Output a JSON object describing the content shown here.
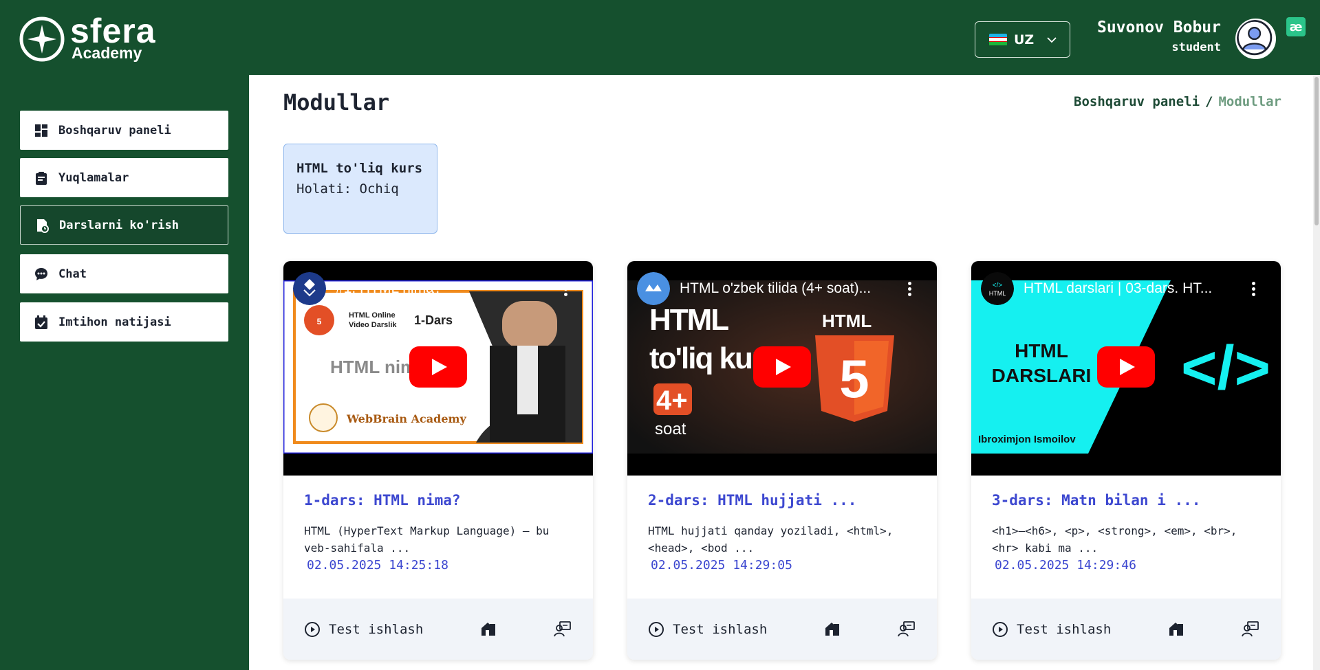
{
  "brand": {
    "name": "sfera",
    "sub": "Academy"
  },
  "header": {
    "language": "UZ",
    "user_name": "Suvonov Bobur",
    "user_role": "student",
    "ext_badge": "æ"
  },
  "sidebar": {
    "items": [
      {
        "label": "Boshqaruv paneli",
        "icon": "dashboard-icon"
      },
      {
        "label": "Yuqlamalar",
        "icon": "clipboard-icon"
      },
      {
        "label": "Darslarni ko'rish",
        "icon": "lesson-icon",
        "active": true
      },
      {
        "label": "Chat",
        "icon": "chat-icon"
      },
      {
        "label": "Imtihon natijasi",
        "icon": "calendar-check-icon"
      }
    ]
  },
  "main": {
    "title": "Modullar",
    "breadcrumb": {
      "home": "Boshqaruv paneli",
      "separator": "/",
      "current": "Modullar"
    },
    "module": {
      "title": "HTML to'liq kurs",
      "status": "Holati: Ochiq"
    }
  },
  "lessons": [
    {
      "title": "1-dars: HTML nima?",
      "desc": "HTML (HyperText Markup Language) – bu veb-sahifala ...",
      "date": "02.05.2025 14:25:18",
      "video_title": "#1. HTML nima?",
      "thumb_texts": [
        "HTML Online",
        "Video Darslik",
        "1-Dars",
        "HTML nima?",
        "WebBrain Academy"
      ],
      "test_label": "Test ishlash"
    },
    {
      "title": "2-dars: HTML hujjati ...",
      "desc": "HTML hujjati qanday yoziladi, <html>, <head>, <bod ...",
      "date": "02.05.2025 14:29:05",
      "video_title": "HTML o'zbek tilida (4+ soat)...",
      "thumb_texts": [
        "HTML",
        "to'liq kurs",
        "HTML",
        "4+",
        "soat"
      ],
      "test_label": "Test ishlash"
    },
    {
      "title": "3-dars: Matn bilan i ...",
      "desc": "<h1>—<h6>, <p>, <strong>, <em>, <br>, <hr> kabi ma ...",
      "date": "02.05.2025 14:29:46",
      "video_title": "HTML darslari | 03-dars. HT...",
      "thumb_texts": [
        "HTML",
        "DARSLARI",
        "Ibroximjon Ismoilov",
        "</>"
      ],
      "test_label": "Test ishlash"
    }
  ],
  "colors": {
    "brand_green": "#15502e",
    "accent_blue": "#3d48d0",
    "module_bg": "#dbe9fd",
    "youtube_red": "#ff0000"
  }
}
